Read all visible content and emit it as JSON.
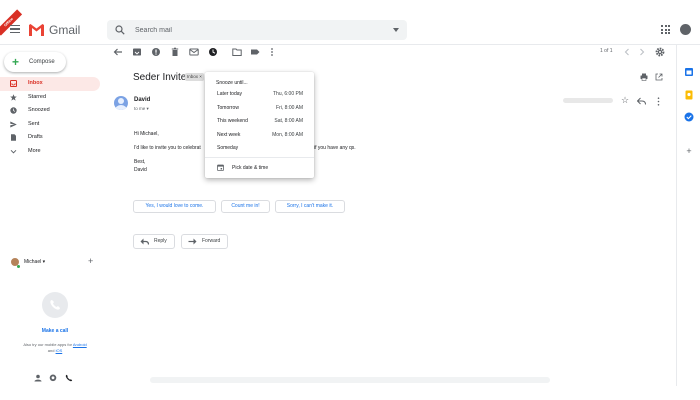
{
  "header": {
    "ribbon": "Offline",
    "brand": "Gmail",
    "search_placeholder": "Search mail"
  },
  "sidebar": {
    "compose": "Compose",
    "items": [
      {
        "label": "Inbox",
        "icon": "inbox-icon",
        "active": true
      },
      {
        "label": "Starred",
        "icon": "star-icon"
      },
      {
        "label": "Snoozed",
        "icon": "clock-icon"
      },
      {
        "label": "Sent",
        "icon": "send-icon"
      },
      {
        "label": "Drafts",
        "icon": "draft-icon"
      },
      {
        "label": "More",
        "icon": "chevron-down-icon"
      }
    ],
    "hangouts_user": "Michael",
    "make_call": "Make a call",
    "also_try_prefix": "Also try our mobile apps for",
    "android": "Android",
    "and": "and",
    "ios": "iOS"
  },
  "toolbar": {
    "pager": "1 of 1"
  },
  "email": {
    "subject": "Seder Invite",
    "label": "Inbox ×",
    "sender": "David",
    "to": "to me ▾",
    "greeting": "Hi Michael,",
    "body_start": "I'd like to invite you to celebrat",
    "body_end": "if you have any qs.",
    "closing": "Best,",
    "signature": "David"
  },
  "smart_replies": [
    "Yes, I would love to come.",
    "Count me in!",
    "Sorry, I can't make it."
  ],
  "actions": {
    "reply": "Reply",
    "forward": "Forward"
  },
  "snooze_menu": {
    "header": "Snooze until...",
    "options": [
      {
        "label": "Later today",
        "time": "Thu, 6:00 PM"
      },
      {
        "label": "Tomorrow",
        "time": "Fri, 8:00 AM"
      },
      {
        "label": "This weekend",
        "time": "Sat, 8:00 AM"
      },
      {
        "label": "Next week",
        "time": "Mon, 8:00 AM"
      },
      {
        "label": "Someday",
        "time": ""
      }
    ],
    "pick": "Pick date & time"
  },
  "colors": {
    "accent": "#1a73e8",
    "inbox_active_bg": "#fce8e6",
    "inbox_active_text": "#d93025",
    "compose_plus": "#34a853"
  }
}
